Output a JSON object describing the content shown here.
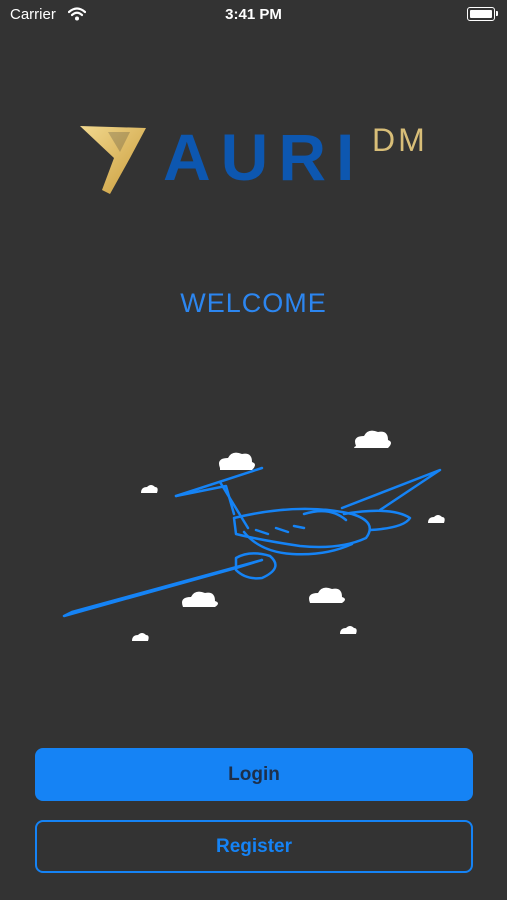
{
  "status_bar": {
    "carrier": "Carrier",
    "time": "3:41 PM",
    "icons": [
      "wifi-icon",
      "battery-icon"
    ]
  },
  "logo": {
    "wordmark": "AURI",
    "suffix": "DM",
    "colors": {
      "mark": "#e4c57a",
      "wordmark": "#0d57b0",
      "suffix": "#d8be78"
    }
  },
  "welcome": {
    "title": "WELCOME"
  },
  "illustration": {
    "subject": "airplane-icon",
    "decorations": "cloud-icon"
  },
  "actions": {
    "login_label": "Login",
    "register_label": "Register"
  },
  "colors": {
    "background": "#333333",
    "accent": "#1583f5"
  }
}
